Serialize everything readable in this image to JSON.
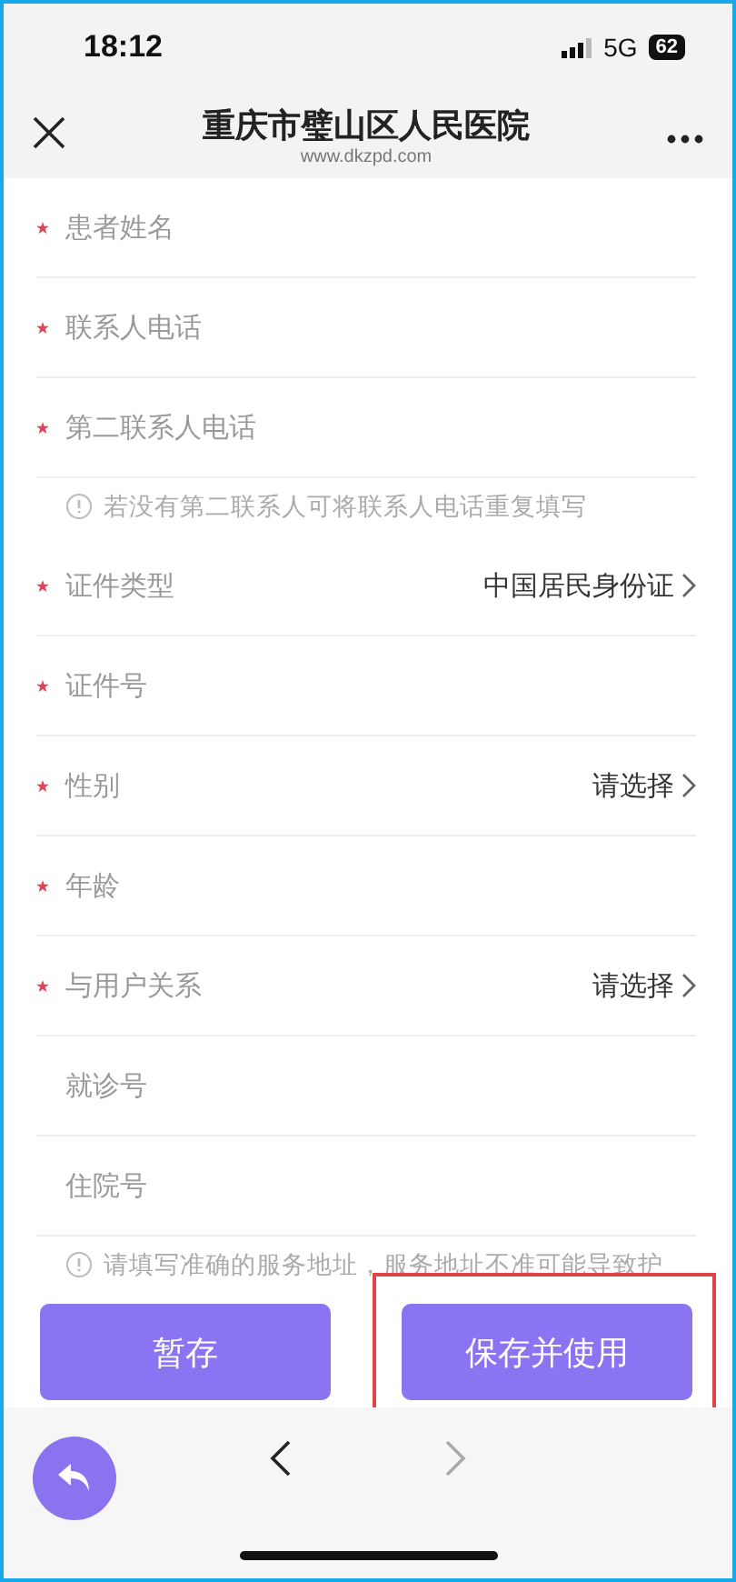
{
  "status_bar": {
    "time": "18:12",
    "network": "5G",
    "battery": "62"
  },
  "nav_bar": {
    "title": "重庆市璧山区人民医院",
    "url": "www.dkzpd.com"
  },
  "form": {
    "rows": [
      {
        "kind": "input",
        "placeholder": "患者姓名",
        "required": true
      },
      {
        "kind": "input",
        "placeholder": "联系人电话",
        "required": true
      },
      {
        "kind": "input",
        "placeholder": "第二联系人电话",
        "required": true
      },
      {
        "kind": "hint",
        "text": "若没有第二联系人可将联系人电话重复填写"
      },
      {
        "kind": "select",
        "label": "证件类型",
        "required": true,
        "value": "中国居民身份证"
      },
      {
        "kind": "input",
        "placeholder": "证件号",
        "required": true
      },
      {
        "kind": "select",
        "label": "性别",
        "required": true,
        "value": "请选择"
      },
      {
        "kind": "input",
        "placeholder": "年龄",
        "required": true
      },
      {
        "kind": "select",
        "label": "与用户关系",
        "required": true,
        "value": "请选择"
      },
      {
        "kind": "input",
        "placeholder": "就诊号",
        "required": false
      },
      {
        "kind": "input",
        "placeholder": "住院号",
        "required": false
      },
      {
        "kind": "hint",
        "text": "请填写准确的服务地址，服务地址不准可能导致护"
      }
    ]
  },
  "buttons": [
    {
      "label": "暂存",
      "highlighted": false
    },
    {
      "label": "保存并使用",
      "highlighted": true
    }
  ]
}
